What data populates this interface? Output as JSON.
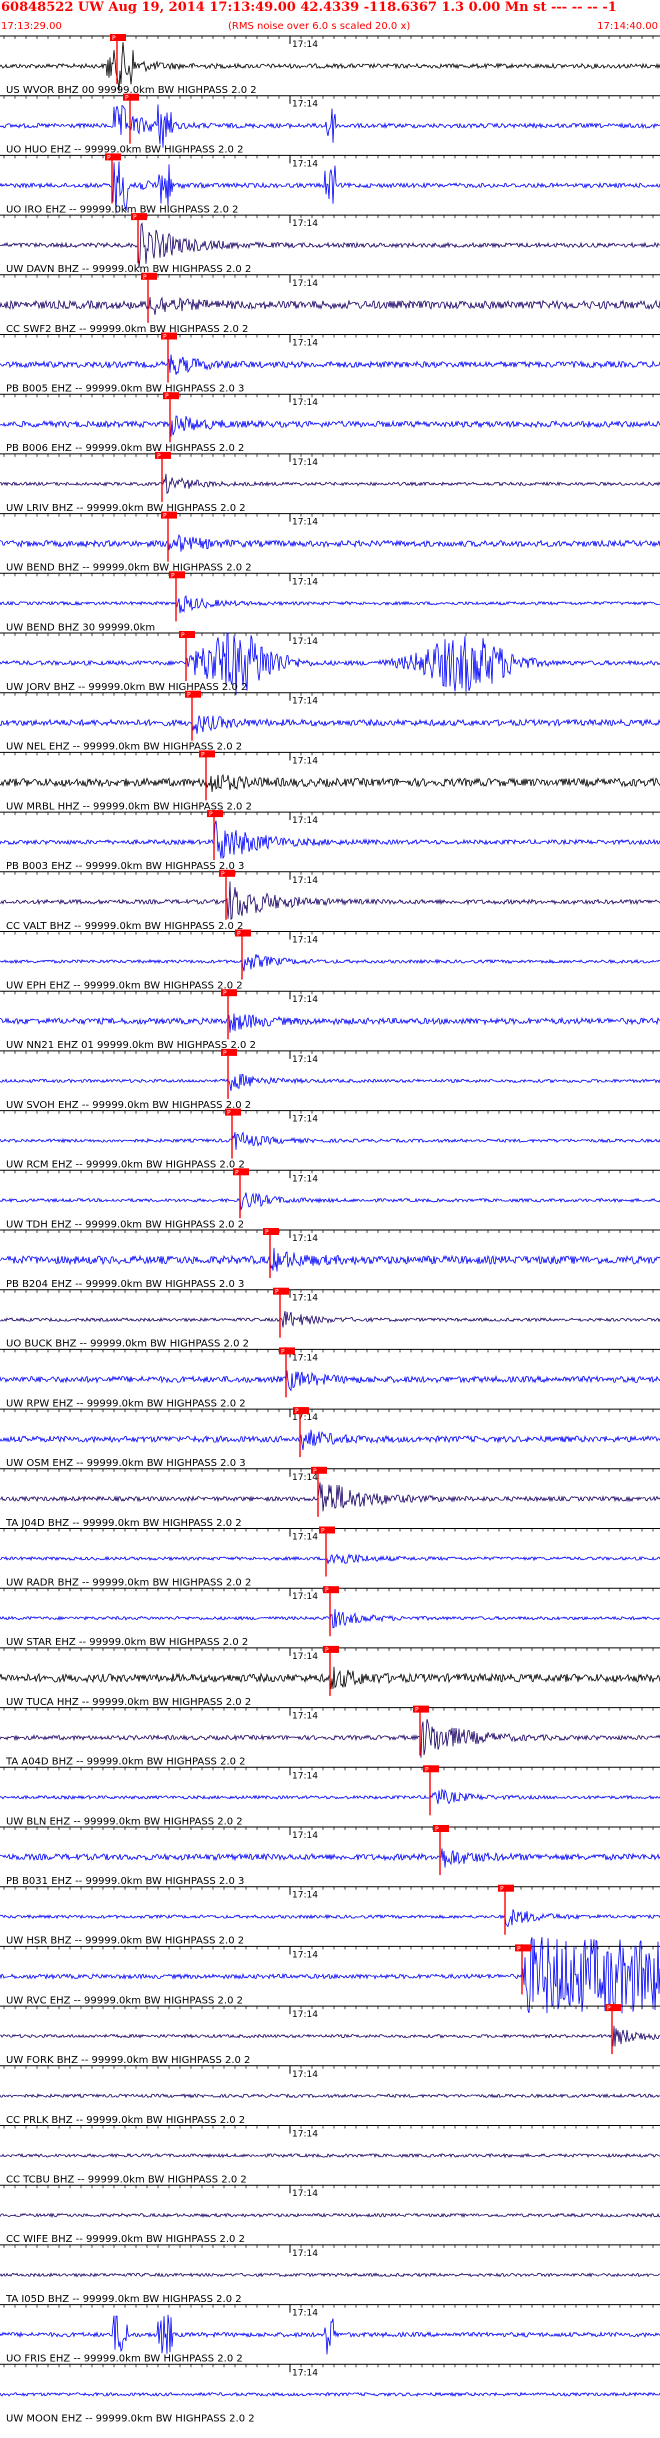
{
  "header": {
    "title": "60848522 UW Aug 19, 2014 17:13:49.00   42.4339 -118.6367  1.3 0.00 Mn st --- -- --   -1",
    "start_time": "17:13:29.00",
    "noise_note": "(RMS noise over 6.0 s scaled 20.0 x)",
    "end_time": "17:14:40.00"
  },
  "chart_data": {
    "type": "line",
    "title": "60848522 UW Aug 19, 2014 17:13:49.00   42.4339 -118.6367  1.3 0.00 Mn st --- -- --   -1",
    "x_start": "17:13:29.00",
    "x_end": "17:14:40.00",
    "minute_label": "17:14",
    "note": "(RMS noise over 6.0 s scaled 20.0 x)",
    "pick_label": "P",
    "traces": [
      {
        "label": "US WVOR BHZ 00 99999.0km BW  HIGHPASS  2.0  2",
        "color": "#000000",
        "pick": 117,
        "energy": "early"
      },
      {
        "label": "UO HUO EHZ -- 99999.0km BW  HIGHPASS  2.0  2",
        "color": "#0000ff",
        "pick": 130,
        "energy": "bursts"
      },
      {
        "label": "UO IRO EHZ -- 99999.0km BW  HIGHPASS  2.0  2",
        "color": "#0000ff",
        "pick": 112,
        "energy": "bursts"
      },
      {
        "label": "UW DAVN BHZ -- 99999.0km BW  HIGHPASS  2.0  2",
        "color": "#1a0066",
        "pick": 138,
        "energy": "packet"
      },
      {
        "label": "CC SWF2 BHZ -- 99999.0km BW  HIGHPASS  2.0  2",
        "color": "#1a0066",
        "pick": 148,
        "energy": "noisy"
      },
      {
        "label": "PB B005 EHZ -- 99999.0km BW  HIGHPASS  2.0  3",
        "color": "#0000ff",
        "pick": 168,
        "energy": "steady"
      },
      {
        "label": "PB B006 EHZ -- 99999.0km BW  HIGHPASS  2.0  2",
        "color": "#0000ff",
        "pick": 170,
        "energy": "steady"
      },
      {
        "label": "UW LRIV BHZ -- 99999.0km BW  HIGHPASS  2.0  2",
        "color": "#1a0066",
        "pick": 162,
        "energy": "quiet"
      },
      {
        "label": "UW BEND BHZ -- 99999.0km BW  HIGHPASS  2.0  2",
        "color": "#0000ff",
        "pick": 168,
        "energy": "steady"
      },
      {
        "label": "UW BEND BHZ 30 99999.0km",
        "color": "#0000ff",
        "pick": 176,
        "energy": "quiet"
      },
      {
        "label": "UW JORV BHZ -- 99999.0km BW  HIGHPASS  2.0  2",
        "color": "#0000ff",
        "pick": 186,
        "energy": "big"
      },
      {
        "label": "UW NEL EHZ -- 99999.0km BW  HIGHPASS  2.0  2",
        "color": "#0000ff",
        "pick": 192,
        "energy": "steady"
      },
      {
        "label": "UW MRBL HHZ -- 99999.0km BW  HIGHPASS  2.0  2",
        "color": "#000000",
        "pick": 206,
        "energy": "noisy"
      },
      {
        "label": "PB B003 EHZ -- 99999.0km BW  HIGHPASS  2.0  3",
        "color": "#0000ff",
        "pick": 214,
        "energy": "packet"
      },
      {
        "label": "CC VALT BHZ -- 99999.0km BW  HIGHPASS  2.0  2",
        "color": "#1a0066",
        "pick": 226,
        "energy": "packet"
      },
      {
        "label": "UW EPH EHZ -- 99999.0km BW  HIGHPASS  2.0  2",
        "color": "#0000ff",
        "pick": 242,
        "energy": "quiet"
      },
      {
        "label": "UW NN21 EHZ 01 99999.0km BW  HIGHPASS  2.0  2",
        "color": "#0000ff",
        "pick": 228,
        "energy": "steady"
      },
      {
        "label": "UW SVOH EHZ -- 99999.0km BW  HIGHPASS  2.0  2",
        "color": "#0000ff",
        "pick": 228,
        "energy": "quiet"
      },
      {
        "label": "UW RCM EHZ -- 99999.0km BW  HIGHPASS  2.0  2",
        "color": "#0000ff",
        "pick": 232,
        "energy": "quiet"
      },
      {
        "label": "UW TDH EHZ -- 99999.0km BW  HIGHPASS  2.0  2",
        "color": "#0000ff",
        "pick": 240,
        "energy": "quiet"
      },
      {
        "label": "PB B204 EHZ -- 99999.0km BW  HIGHPASS  2.0  3",
        "color": "#0000ff",
        "pick": 270,
        "energy": "noisy"
      },
      {
        "label": "UO BUCK BHZ -- 99999.0km BW  HIGHPASS  2.0  2",
        "color": "#1a0066",
        "pick": 280,
        "energy": "quiet"
      },
      {
        "label": "UW RPW EHZ -- 99999.0km BW  HIGHPASS  2.0  2",
        "color": "#0000ff",
        "pick": 286,
        "energy": "steady"
      },
      {
        "label": "UW OSM EHZ -- 99999.0km BW  HIGHPASS  2.0  3",
        "color": "#0000ff",
        "pick": 300,
        "energy": "steady"
      },
      {
        "label": "TA J04D BHZ -- 99999.0km BW  HIGHPASS  2.0  2",
        "color": "#1a0066",
        "pick": 318,
        "energy": "packet"
      },
      {
        "label": "UW RADR BHZ -- 99999.0km BW  HIGHPASS  2.0  2",
        "color": "#0000ff",
        "pick": 326,
        "energy": "quiet"
      },
      {
        "label": "UW STAR EHZ -- 99999.0km BW  HIGHPASS  2.0  2",
        "color": "#0000ff",
        "pick": 330,
        "energy": "quiet"
      },
      {
        "label": "UW TUCA HHZ -- 99999.0km BW  HIGHPASS  2.0  2",
        "color": "#000000",
        "pick": 330,
        "energy": "noisy"
      },
      {
        "label": "TA A04D BHZ -- 99999.0km BW  HIGHPASS  2.0  2",
        "color": "#1a0066",
        "pick": 420,
        "energy": "packet"
      },
      {
        "label": "UW BLN EHZ -- 99999.0km BW  HIGHPASS  2.0  2",
        "color": "#0000ff",
        "pick": 430,
        "energy": "quiet"
      },
      {
        "label": "PB B031 EHZ -- 99999.0km BW  HIGHPASS  2.0  3",
        "color": "#0000ff",
        "pick": 440,
        "energy": "steady"
      },
      {
        "label": "UW HSR BHZ -- 99999.0km BW  HIGHPASS  2.0  2",
        "color": "#0000ff",
        "pick": 505,
        "energy": "quiet"
      },
      {
        "label": "UW RVC EHZ -- 99999.0km BW  HIGHPASS  2.0  2",
        "color": "#0000ff",
        "pick": 522,
        "energy": "big-late"
      },
      {
        "label": "UW FORK BHZ -- 99999.0km BW  HIGHPASS  2.0  2",
        "color": "#1a0066",
        "pick": 612,
        "energy": "quiet"
      },
      {
        "label": "CC PRLK BHZ -- 99999.0km BW  HIGHPASS  2.0  2",
        "color": "#1a0066",
        "pick": null,
        "energy": "quiet"
      },
      {
        "label": "CC TCBU BHZ -- 99999.0km BW  HIGHPASS  2.0  2",
        "color": "#1a0066",
        "pick": null,
        "energy": "quiet"
      },
      {
        "label": "CC WIFE BHZ -- 99999.0km BW  HIGHPASS  2.0  2",
        "color": "#1a0066",
        "pick": null,
        "energy": "quiet"
      },
      {
        "label": "TA I05D BHZ -- 99999.0km BW  HIGHPASS  2.0  2",
        "color": "#1a0066",
        "pick": null,
        "energy": "quiet"
      },
      {
        "label": "UO FRIS EHZ -- 99999.0km BW  HIGHPASS  2.0  2",
        "color": "#0000ff",
        "pick": null,
        "energy": "bursts"
      },
      {
        "label": "UW MOON EHZ -- 99999.0km BW  HIGHPASS  2.0  2",
        "color": "#0000ff",
        "pick": null,
        "energy": "quiet"
      }
    ]
  }
}
